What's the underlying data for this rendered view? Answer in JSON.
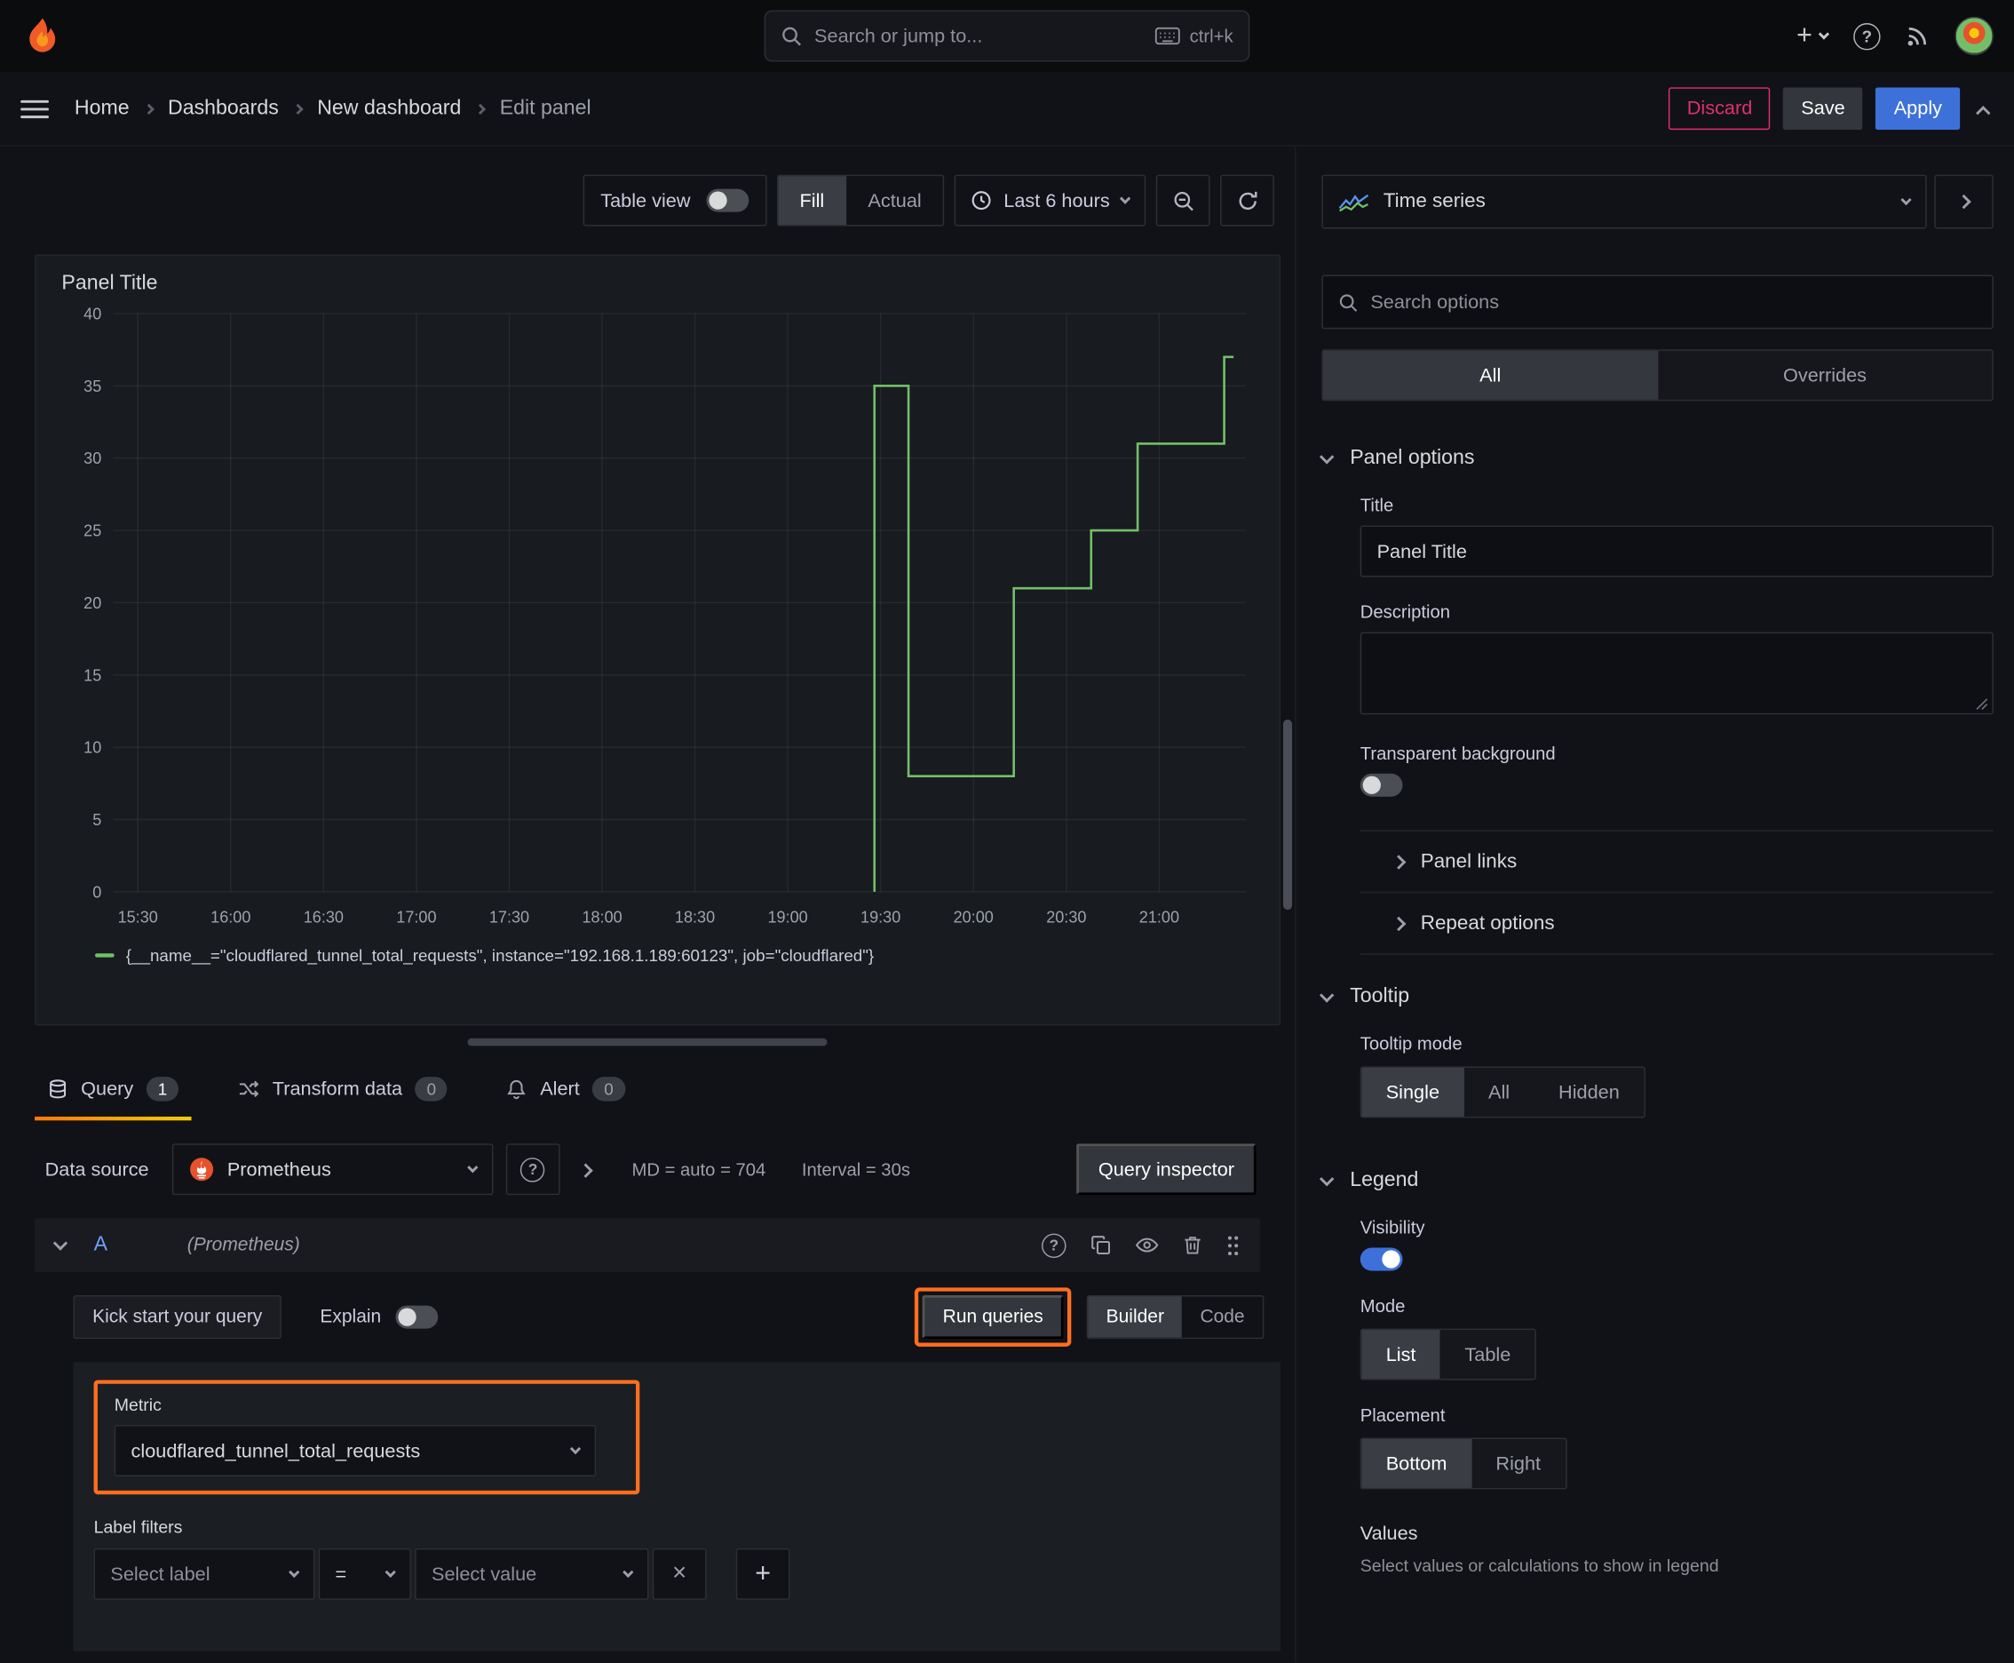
{
  "colors": {
    "accent_blue": "#3d71d9",
    "annotation_orange": "#ff6e1f",
    "series_green": "#73bf69",
    "discard_red": "#e0316c",
    "tab_underline_orange": "#ff780a"
  },
  "icons": {
    "plus": "+",
    "help": "?",
    "close": "×"
  },
  "topbar": {
    "search_placeholder": "Search or jump to...",
    "shortcut": "ctrl+k"
  },
  "breadcrumb": {
    "items": [
      "Home",
      "Dashboards",
      "New dashboard",
      "Edit panel"
    ],
    "discard": "Discard",
    "save": "Save",
    "apply": "Apply"
  },
  "toolbar": {
    "table_view": "Table view",
    "fill": "Fill",
    "actual": "Actual",
    "time_range": "Last 6 hours"
  },
  "panel": {
    "title": "Panel Title",
    "legend": "{__name__=\"cloudflared_tunnel_total_requests\", instance=\"192.168.1.189:60123\", job=\"cloudflared\"}"
  },
  "chart_data": {
    "type": "line",
    "line_style": "step",
    "title": "Panel Title",
    "x_ticks": [
      "15:30",
      "16:00",
      "16:30",
      "17:00",
      "17:30",
      "18:00",
      "18:30",
      "19:00",
      "19:30",
      "20:00",
      "20:30",
      "21:00"
    ],
    "x_tick_minutes": [
      0,
      30,
      60,
      90,
      120,
      150,
      180,
      210,
      240,
      270,
      300,
      330
    ],
    "x_range_minutes": [
      -8,
      358
    ],
    "y_ticks": [
      0,
      5,
      10,
      15,
      20,
      25,
      30,
      35,
      40
    ],
    "ylim": [
      0,
      40
    ],
    "grid": true,
    "legend_position": "bottom",
    "series": [
      {
        "name": "{__name__=\"cloudflared_tunnel_total_requests\", instance=\"192.168.1.189:60123\", job=\"cloudflared\"}",
        "color": "#73bf69",
        "points": [
          [
            238,
            0
          ],
          [
            238,
            35
          ],
          [
            249,
            35
          ],
          [
            249,
            8
          ],
          [
            283,
            8
          ],
          [
            283,
            21
          ],
          [
            308,
            21
          ],
          [
            308,
            25
          ],
          [
            323,
            25
          ],
          [
            323,
            31
          ],
          [
            351,
            31
          ],
          [
            351,
            37
          ],
          [
            354,
            37
          ]
        ]
      }
    ]
  },
  "tabs": {
    "query": "Query",
    "query_count": "1",
    "transform": "Transform data",
    "transform_count": "0",
    "alert": "Alert",
    "alert_count": "0"
  },
  "datasource": {
    "label": "Data source",
    "name": "Prometheus",
    "md": "MD = auto = 704",
    "interval": "Interval = 30s",
    "inspector": "Query inspector"
  },
  "query": {
    "ref_id": "A",
    "ds_hint": "(Prometheus)",
    "kick_start": "Kick start your query",
    "explain": "Explain",
    "run": "Run queries",
    "builder": "Builder",
    "code": "Code",
    "metric_label": "Metric",
    "metric_value": "cloudflared_tunnel_total_requests",
    "filters_label": "Label filters",
    "select_label": "Select label",
    "operator": "=",
    "select_value": "Select value"
  },
  "sidebar": {
    "viz_name": "Time series",
    "search_placeholder": "Search options",
    "tab_all": "All",
    "tab_overrides": "Overrides",
    "panel_options": {
      "header": "Panel options",
      "title_label": "Title",
      "title_value": "Panel Title",
      "description_label": "Description",
      "transparent_label": "Transparent background",
      "panel_links": "Panel links",
      "repeat_options": "Repeat options"
    },
    "tooltip": {
      "header": "Tooltip",
      "mode_label": "Tooltip mode",
      "options": [
        "Single",
        "All",
        "Hidden"
      ]
    },
    "legend": {
      "header": "Legend",
      "visibility_label": "Visibility",
      "mode_label": "Mode",
      "mode_options": [
        "List",
        "Table"
      ],
      "placement_label": "Placement",
      "placement_options": [
        "Bottom",
        "Right"
      ],
      "values_label": "Values",
      "values_desc": "Select values or calculations to show in legend"
    }
  }
}
